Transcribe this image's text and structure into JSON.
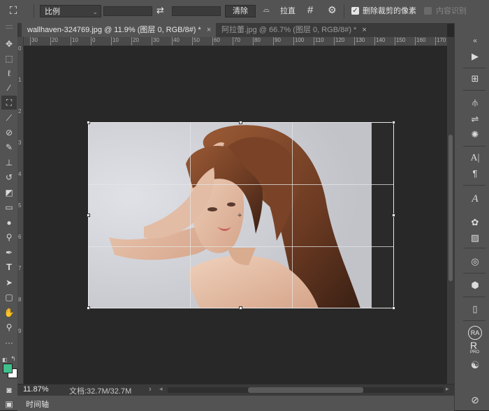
{
  "options_bar": {
    "crop_tool_icon": "crop-icon",
    "ratio_dropdown": "比例",
    "swap_icon": "swap-arrows-icon",
    "clear_button": "清除",
    "straighten_label": "拉直",
    "straighten_icon": "level-icon",
    "overlay_icon": "grid-overlay-icon",
    "settings_icon": "gear-icon",
    "delete_cropped_checked": true,
    "delete_cropped_label": "删除裁剪的像素",
    "content_aware_label": "内容识别"
  },
  "tabs": [
    {
      "label": "wallhaven-324769.jpg @ 11.9% (图层 0, RGB/8#) *",
      "close": "×",
      "active": true
    },
    {
      "label": "阿拉蕾.jpg @ 66.7% (图层 0, RGB/8#) *",
      "close": "×",
      "active": false
    }
  ],
  "ruler": {
    "h_ticks": [
      "30",
      "20",
      "10",
      "0",
      "10",
      "20",
      "30",
      "40",
      "50",
      "60",
      "70",
      "80",
      "90",
      "100",
      "110",
      "120",
      "130",
      "140",
      "150",
      "160",
      "170"
    ],
    "v_ticks": [
      "0",
      "1",
      "2",
      "3",
      "4",
      "5",
      "6",
      "7",
      "8",
      "9"
    ]
  },
  "status": {
    "zoom": "11.87%",
    "doc": "文档:32.7M/32.7M",
    "arrow": "›"
  },
  "timeline": {
    "label": "时间轴"
  },
  "tools": [
    "move-icon",
    "marquee-icon",
    "lasso-icon",
    "quick-select-icon",
    "crop-icon",
    "eyedropper-icon",
    "healing-icon",
    "brush-icon",
    "stamp-icon",
    "history-brush-icon",
    "eraser-icon",
    "gradient-icon",
    "blur-icon",
    "dodge-icon",
    "pen-icon",
    "type-icon",
    "path-select-icon",
    "shape-icon",
    "hand-icon",
    "zoom-icon",
    "more-icon"
  ],
  "colors": {
    "foreground": "#3ec18c",
    "background": "#ffffff"
  },
  "right_panel": {
    "icons": [
      "collapse-icon",
      "play-icon",
      "history-icon",
      "brush-settings-icon",
      "adjust-icon",
      "character-icon",
      "paragraph-icon",
      "glyph-icon",
      "brush-preset-icon",
      "image-icon",
      "swatches-icon",
      "3d-icon",
      "device-icon",
      "ra-plugin-icon",
      "r-pro-plugin-icon",
      "yin-yang-icon",
      "no-icon"
    ],
    "ra_label": "RA",
    "r_label": "R",
    "r_sub": "PRO"
  }
}
